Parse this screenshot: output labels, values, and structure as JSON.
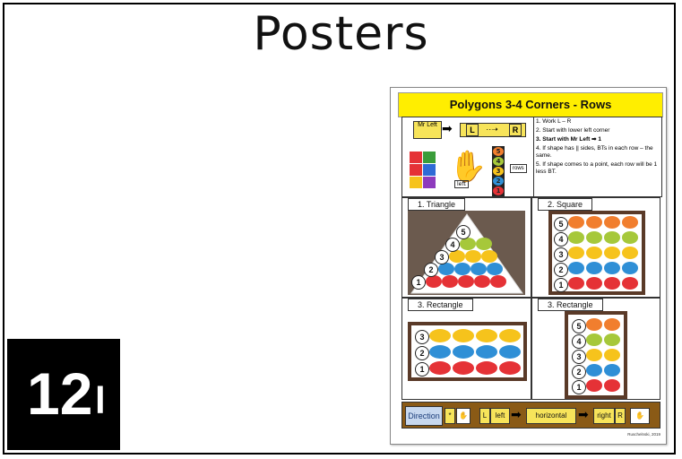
{
  "slide": {
    "title": "Posters",
    "badge_number": "12",
    "badge_suffix": "l"
  },
  "poster": {
    "header": "Polygons 3-4 Corners  - Rows",
    "intro": {
      "mr_left_label": "Mr Left",
      "left_letter": "L",
      "right_letter": "R",
      "rows_label": "rows",
      "hand_tag": "left",
      "steps": [
        "1.  Work L – R",
        "2.  Start with lower left corner",
        "3. Start with Mr Left ➡ 1",
        "4. If shape has || sides, BTs in each row – the same.",
        "5. If shape comes to a point, each row will be 1 less BT."
      ],
      "stack_numbers": [
        "5",
        "4",
        "3",
        "2",
        "1"
      ]
    },
    "panels": [
      {
        "label": "1. Triangle",
        "row_numbers": [
          "5",
          "4",
          "3",
          "2",
          "1"
        ]
      },
      {
        "label": "2.  Square",
        "row_numbers": [
          "5",
          "4",
          "3",
          "2",
          "1"
        ]
      },
      {
        "label": "3. Rectangle",
        "row_numbers": [
          "3",
          "2",
          "1"
        ]
      },
      {
        "label": "3. Rectangle",
        "row_numbers": [
          "5",
          "4",
          "3",
          "2",
          "1"
        ]
      }
    ],
    "direction_bar": {
      "label": "Direction",
      "star": "*",
      "left_letter": "L",
      "left_word": "left",
      "middle_word": "horizontal",
      "right_word": "right",
      "right_letter": "R"
    },
    "copyright": "Ruschelnski, 2019"
  },
  "colors": {
    "row1": "#e53236",
    "row2": "#2f8fd6",
    "row3": "#f6c31c",
    "row4": "#a6c83a",
    "row5": "#f17e2e",
    "header_bg": "#ffee00"
  }
}
